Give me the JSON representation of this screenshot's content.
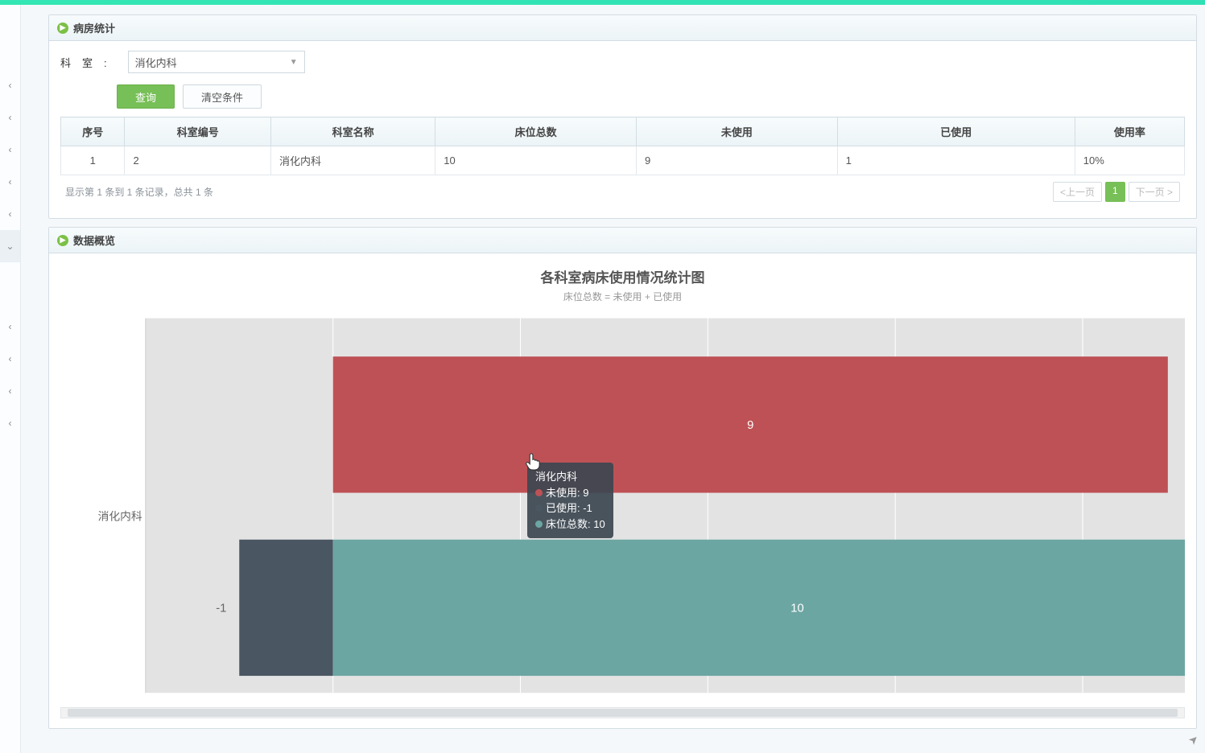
{
  "panel1": {
    "title": "病房统计"
  },
  "panel2": {
    "title": "数据概览"
  },
  "filter": {
    "label": "科室:",
    "selected": "消化内科",
    "search_btn": "查询",
    "clear_btn": "清空条件"
  },
  "table": {
    "headers": [
      "序号",
      "科室编号",
      "科室名称",
      "床位总数",
      "未使用",
      "已使用",
      "使用率"
    ],
    "rows": [
      {
        "seq": "1",
        "dept_no": "2",
        "dept_name": "消化内科",
        "total": "10",
        "unused": "9",
        "used": "1",
        "rate": "10%"
      }
    ],
    "footer_info": "显示第 1 条到 1 条记录，总共 1 条",
    "prev": "<上一页",
    "page": "1",
    "next": "下一页 >"
  },
  "chart": {
    "title": "各科室病床使用情况统计图",
    "subtitle": "床位总数 = 未使用 + 已使用",
    "category": "消化内科",
    "tooltip": {
      "cat": "消化内科",
      "l1": "未使用: 9",
      "l2": "已使用: -1",
      "l3": "床位总数: 10"
    },
    "bar_labels": {
      "unused": "9",
      "used": "-1",
      "total": "10"
    }
  },
  "colors": {
    "unused": "#be5155",
    "used": "#4a5662",
    "total": "#6ca6a3",
    "plot_bg": "#e3e3e3",
    "grid": "#d0d0d0"
  },
  "chart_data": {
    "type": "bar",
    "orientation": "horizontal",
    "title": "各科室病床使用情况统计图",
    "subtitle": "床位总数 = 未使用 + 已使用",
    "categories": [
      "消化内科"
    ],
    "series": [
      {
        "name": "未使用",
        "values": [
          9
        ]
      },
      {
        "name": "已使用",
        "values": [
          -1
        ]
      },
      {
        "name": "床位总数",
        "values": [
          10
        ]
      }
    ],
    "xlim": [
      -1,
      10
    ]
  }
}
